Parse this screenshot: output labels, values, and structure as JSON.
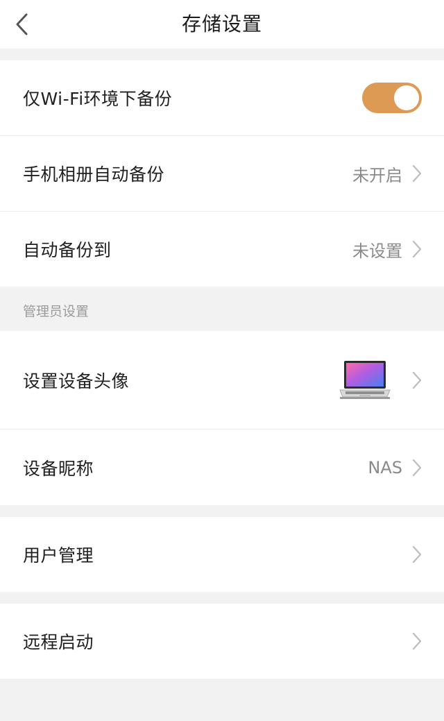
{
  "header": {
    "title": "存储设置",
    "back_icon": "chevron-left-icon"
  },
  "rows": {
    "wifi_only": {
      "label": "仅Wi-Fi环境下备份",
      "toggle_on": true,
      "toggle_color": "#dd9a55"
    },
    "album_backup": {
      "label": "手机相册自动备份",
      "value": "未开启"
    },
    "backup_to": {
      "label": "自动备份到",
      "value": "未设置"
    }
  },
  "admin_section": {
    "title": "管理员设置"
  },
  "admin_rows": {
    "device_avatar": {
      "label": "设置设备头像",
      "image": "laptop-image"
    },
    "device_name": {
      "label": "设备昵称",
      "value": "NAS"
    }
  },
  "user_management": {
    "label": "用户管理"
  },
  "remote_start": {
    "label": "远程启动"
  }
}
